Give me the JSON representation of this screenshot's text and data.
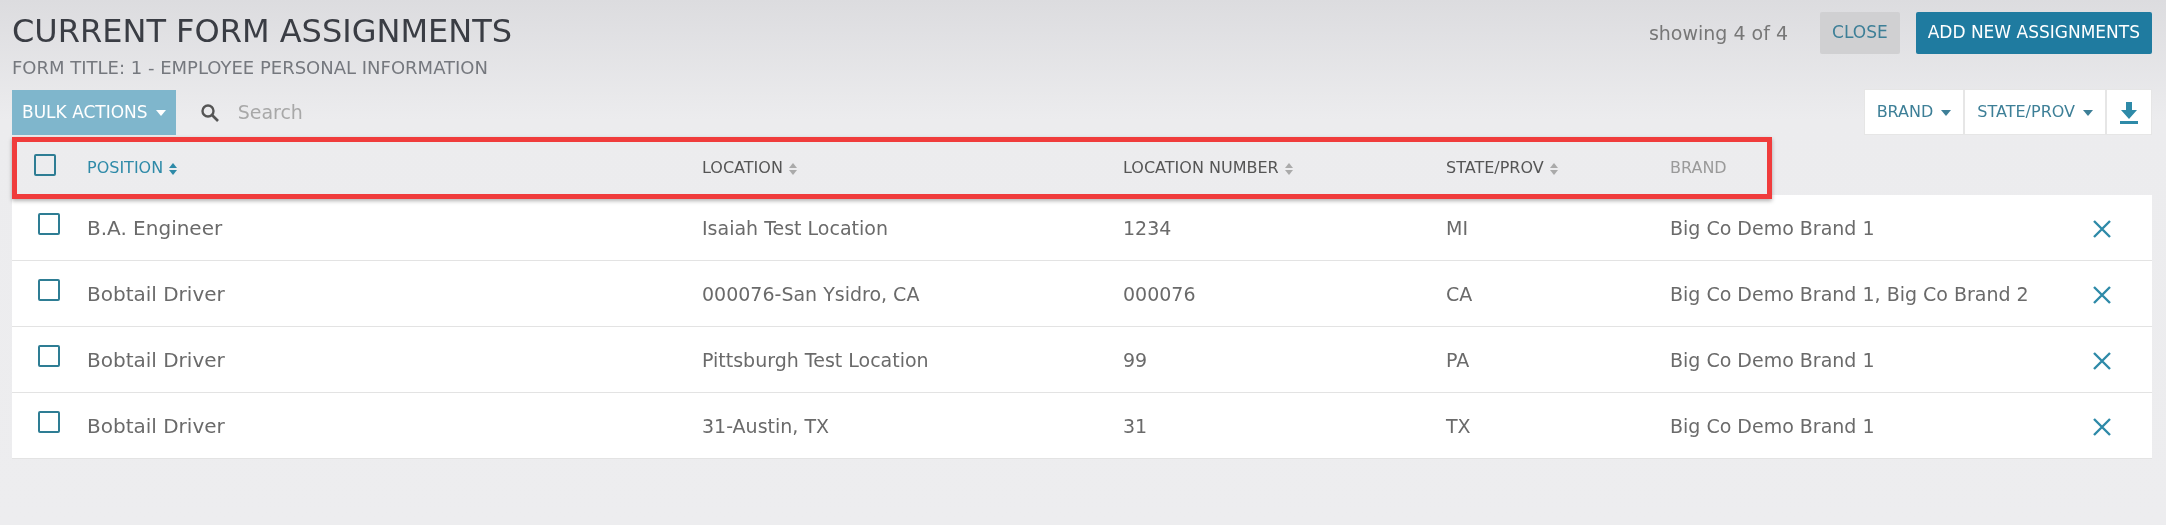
{
  "title": "CURRENT FORM ASSIGNMENTS",
  "subtitle": "FORM TITLE: 1 - EMPLOYEE PERSONAL INFORMATION",
  "showing": "showing 4 of 4",
  "buttons": [
    {
      "label": "CLOSE",
      "kind": "secondary"
    },
    {
      "label": "ADD NEW ASSIGNMENTS",
      "kind": "primary"
    }
  ],
  "bulk_actions": {
    "label": "BULK ACTIONS",
    "disabled": true
  },
  "search": {
    "placeholder": "Search"
  },
  "filters": [
    {
      "label": "BRAND"
    },
    {
      "label": "STATE/PROV"
    }
  ],
  "table": {
    "header_highlighted": true,
    "all_checked": false,
    "columns": [
      {
        "label": "POSITION",
        "sortable": true,
        "selected": true
      },
      {
        "label": "LOCATION",
        "sortable": true,
        "selected": false
      },
      {
        "label": "LOCATION NUMBER",
        "sortable": true,
        "selected": false
      },
      {
        "label": "STATE/PROV",
        "sortable": true,
        "selected": false
      },
      {
        "label": "BRAND",
        "sortable": false,
        "selected": false
      }
    ],
    "rows": [
      {
        "checked": false,
        "cells": [
          "B.A. Engineer",
          "Isaiah Test Location",
          "1234",
          "MI",
          "Big Co Demo Brand 1"
        ]
      },
      {
        "checked": false,
        "cells": [
          "Bobtail Driver",
          "000076-San Ysidro, CA",
          "000076",
          "CA",
          "Big Co Demo Brand 1, Big Co Brand 2"
        ]
      },
      {
        "checked": false,
        "cells": [
          "Bobtail Driver",
          "Pittsburgh Test Location",
          "99",
          "PA",
          "Big Co Demo Brand 1"
        ]
      },
      {
        "checked": false,
        "cells": [
          "Bobtail Driver",
          "31-Austin, TX",
          "31",
          "TX",
          "Big Co Demo Brand 1"
        ]
      }
    ]
  }
}
